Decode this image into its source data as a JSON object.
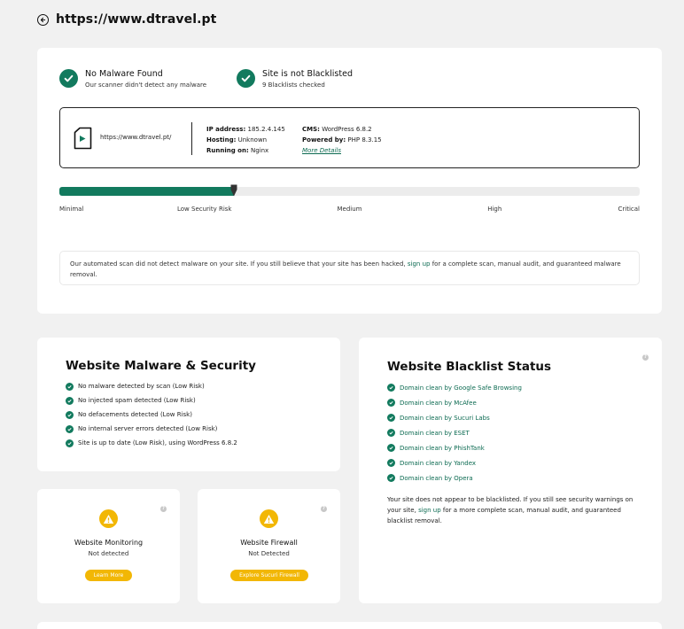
{
  "header": {
    "url": "https://www.dtravel.pt"
  },
  "summary": {
    "malware_title": "No Malware Found",
    "malware_sub": "Our scanner didn't detect any malware",
    "blacklist_title": "Site is not Blacklisted",
    "blacklist_sub": "9 Blacklists checked"
  },
  "site": {
    "url": "https://www.dtravel.pt/",
    "ip_label": "IP address:",
    "ip_value": "185.2.4.145",
    "hosting_label": "Hosting:",
    "hosting_value": "Unknown",
    "running_label": "Running on:",
    "running_value": "Nginx",
    "cms_label": "CMS:",
    "cms_value": "WordPress 6.8.2",
    "powered_label": "Powered by:",
    "powered_value": "PHP 8.3.15",
    "more_details": "More Details"
  },
  "risk": {
    "level": 0.3,
    "labels": [
      "Minimal",
      "Low Security Risk",
      "Medium",
      "High",
      "Critical"
    ],
    "color": "#127a5e"
  },
  "note": {
    "before": "Our automated scan did not detect malware on your site. If you still believe that your site has been hacked,",
    "link": "sign up",
    "after": "for a complete scan, manual audit, and guaranteed malware removal."
  },
  "malware_card": {
    "title": "Website Malware & Security",
    "items": [
      "No malware detected by scan (Low Risk)",
      "No injected spam detected (Low Risk)",
      "No defacements detected (Low Risk)",
      "No internal server errors detected (Low Risk)",
      "Site is up to date (Low Risk), using WordPress 6.8.2"
    ]
  },
  "blacklist_card": {
    "title": "Website Blacklist Status",
    "items": [
      "Domain clean by Google Safe Browsing",
      "Domain clean by McAfee",
      "Domain clean by Sucuri Labs",
      "Domain clean by ESET",
      "Domain clean by PhishTank",
      "Domain clean by Yandex",
      "Domain clean by Opera"
    ],
    "note_before": "Your site does not appear to be blacklisted. If you still see security warnings on your site,",
    "note_link": "sign up",
    "note_after": "for a more complete scan, manual audit, and guaranteed blacklist removal."
  },
  "monitor_card": {
    "title": "Website Monitoring",
    "status": "Not detected",
    "button": "Learn More"
  },
  "firewall_card": {
    "title": "Website Firewall",
    "status": "Not Detected",
    "button": "Explore Sucuri Firewall"
  },
  "help_glyph": "?",
  "colors": {
    "accent": "#127a5e",
    "warning": "#f2b705",
    "background": "#f1f1f1"
  }
}
